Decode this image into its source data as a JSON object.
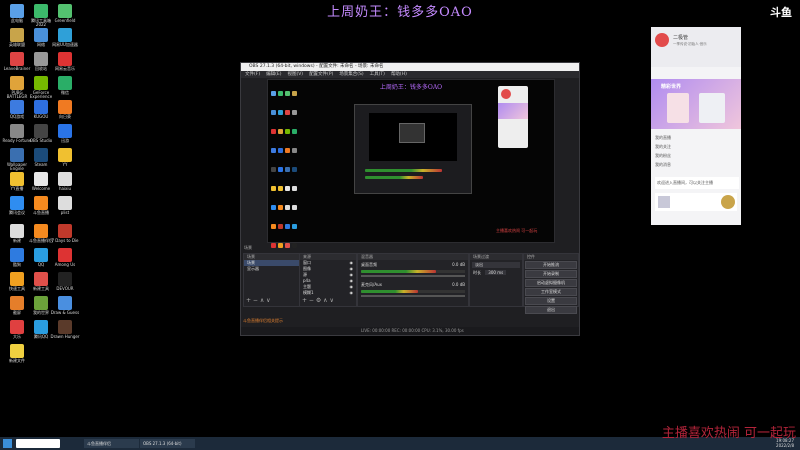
{
  "overlay": {
    "title": "上周奶王：钱多多OAO",
    "logo": "斗鱼",
    "slogan": "主播喜欢热闹 可一起玩"
  },
  "desktop_icons": [
    {
      "label": "此电脑",
      "color": "#5aa0e8"
    },
    {
      "label": "腾讯工具箱 2022",
      "color": "#3cba6b"
    },
    {
      "label": "Greenfield",
      "color": "#54c270"
    },
    {
      "label": "英雄联盟",
      "color": "#c8a44a"
    },
    {
      "label": "网络",
      "color": "#4a90d9"
    },
    {
      "label": "网易UU加速器",
      "color": "#2fa0d8"
    },
    {
      "label": "LeaveBrainer",
      "color": "#d44"
    },
    {
      "label": "回收站",
      "color": "#999"
    },
    {
      "label": "网易云音乐",
      "color": "#d33"
    },
    {
      "label": "PUBG BATTLEGR",
      "color": "#e0a33a"
    },
    {
      "label": "GeForce Experience",
      "color": "#76b900"
    },
    {
      "label": "微信",
      "color": "#2aae67"
    },
    {
      "label": "QQ游戏",
      "color": "#3d7be0"
    },
    {
      "label": "KUGOU",
      "color": "#2e6fe0"
    },
    {
      "label": "向日葵",
      "color": "#f07a22"
    },
    {
      "label": "Ready Fortune",
      "color": "#888"
    },
    {
      "label": "OBS Studio",
      "color": "#444"
    },
    {
      "label": "迅游",
      "color": "#2a74e8"
    },
    {
      "label": "Wallpaper Engine",
      "color": "#3a6fb0"
    },
    {
      "label": "Steam",
      "color": "#1b4b7a"
    },
    {
      "label": "YY",
      "color": "#f0c030"
    },
    {
      "label": "YY直播",
      "color": "#f0c030"
    },
    {
      "label": "Welcome",
      "color": "#e8e8e8"
    },
    {
      "label": "haixiu",
      "color": "#ddd"
    },
    {
      "label": "腾讯会议",
      "color": "#2f8df0"
    },
    {
      "label": "斗鱼直播",
      "color": "#f58a1f"
    },
    {
      "label": "plist",
      "color": "#ddd"
    },
    {
      "label": "新建",
      "color": "#ddd"
    },
    {
      "label": "斗鱼直播伴侣",
      "color": "#f58a1f"
    },
    {
      "label": "7 Days to Die",
      "color": "#c0392b"
    },
    {
      "label": "酷狗",
      "color": "#2e7be0"
    },
    {
      "label": "QQ",
      "color": "#2a9de0"
    },
    {
      "label": "Among Us",
      "color": "#d33"
    },
    {
      "label": "快速工具",
      "color": "#f0a020"
    },
    {
      "label": "新建工具",
      "color": "#e0504a"
    },
    {
      "label": "DEVOUR",
      "color": "#222"
    },
    {
      "label": "截屏",
      "color": "#e57e2a"
    },
    {
      "label": "我的世界",
      "color": "#6ba23a"
    },
    {
      "label": "Draw & Guess",
      "color": "#4a8fe0"
    },
    {
      "label": "大乐",
      "color": "#e04040"
    },
    {
      "label": "腾讯QQ",
      "color": "#2a9de0"
    },
    {
      "label": "Drawn Hunger",
      "color": "#5a3a2a"
    },
    {
      "label": "新建文件",
      "color": "#f0d040"
    }
  ],
  "obs": {
    "title": "OBS 27.1.3 (64-bit, windows) - 配置文件: 未命名 - 场景: 未命名",
    "menu": [
      "文件(F)",
      "编辑(E)",
      "视图(V)",
      "配置文件(P)",
      "场景集合(S)",
      "工具(T)",
      "帮助(H)"
    ],
    "nested_title": "上周奶王：钱多多OAO",
    "nested_red": "主播喜欢热闹 可一起玩",
    "scene_header": "场景",
    "scenes": [
      "场景",
      "显示器"
    ],
    "source_header": "来源",
    "sources": [
      "窗口",
      "图像",
      "源",
      "p4a",
      "主题",
      "模糊1"
    ],
    "mixer_header": "混音器",
    "mixer": [
      {
        "name": "桌面音频",
        "level": "0.0 dB",
        "fill": 0.72
      },
      {
        "name": "麦克风/Aux",
        "level": "0.0 dB",
        "fill": 0.55
      }
    ],
    "transition_header": "场景过渡",
    "transition_type": "淡出",
    "duration_label": "时长",
    "duration": "300 ms",
    "controls_header": "控件",
    "controls": [
      "开始推流",
      "开始录制",
      "启动虚拟摄像机",
      "工作室模式",
      "设置",
      "退出"
    ],
    "status": "LIVE: 00:00:00   REC: 00:00:00   CPU: 3.1%, 30.00 fps",
    "notice": "斗鱼直播伴侣相关提示"
  },
  "chat": {
    "username": "二极管",
    "signature": "一季传说·初始人·音乐",
    "banner": "精彩世界",
    "messages": [
      "我的直播",
      "我的关注",
      "我的粉丝",
      "我的消息"
    ],
    "highlight": "欢迎进入直播间，可以关注主播"
  },
  "taskbar": {
    "apps": [
      "斗鱼直播伴侣",
      "OBS 27.1.3 (64-bit)"
    ],
    "time": "19:08:27",
    "date": "2022/2/8"
  }
}
